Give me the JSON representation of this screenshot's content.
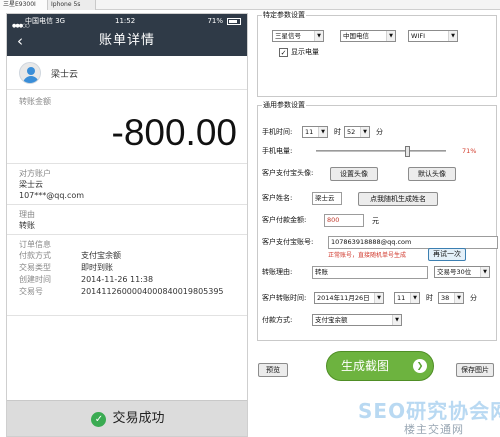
{
  "window_tabs": [
    "三星E9300I",
    "Iphone 5s"
  ],
  "phone": {
    "status": {
      "signal": "●●●○○",
      "carrier": "中国电信  3G",
      "time": "11:52",
      "battery": "71%"
    },
    "nav": {
      "back": "‹",
      "title": "账单详情"
    },
    "user_name": "梁士云",
    "amount_label": "转账金额",
    "amount": "-800.00",
    "counterparty_label": "对方账户",
    "counterparty_name": "梁士云",
    "counterparty_account": "107***@qq.com",
    "reason_label": "理由",
    "reason_value": "转账",
    "order_label": "订单信息",
    "rows": [
      {
        "k": "付款方式",
        "v": "支付宝余额"
      },
      {
        "k": "交易类型",
        "v": "即时到账"
      },
      {
        "k": "创建时间",
        "v": "2014-11-26 11:38"
      },
      {
        "k": "交易号",
        "v": "2014112600004000840019805395"
      }
    ],
    "success_icon": "✓",
    "success_text": "交易成功"
  },
  "panel": {
    "device_group_title": "特定参数设置",
    "device_select": "三星信号",
    "carrier_select": "中国电信",
    "network_select": "WIFI",
    "show_battery_checked": "✓",
    "show_battery_label": "显示电量",
    "general_group_title": "通用参数设置",
    "phone_time_label": "手机时间:",
    "hour": "11",
    "hour_unit": "时",
    "minute": "52",
    "minute_unit": "分",
    "battery_label": "手机电量:",
    "battery_value": 71,
    "battery_pct": "71%",
    "avatar_label": "客户支付宝头像:",
    "set_avatar_button": "设置头像",
    "default_avatar_button": "默认头像",
    "name_label": "客户姓名:",
    "name_value": "梁士云",
    "random_name_button": "点我随机生成姓名",
    "amount_label": "客户付款金额:",
    "amount_value": "800",
    "amount_unit": "元",
    "account_label": "客户支付宝账号:",
    "account_value": "107863918888@qq.com",
    "warning_text": "正常账号，直接随机单号生成",
    "retry_button": "再试一次",
    "reason_label": "转账理由:",
    "reason_value": "转账",
    "trade_number_select": "交易号30位",
    "trade_time_label": "客户转账时间:",
    "trade_date": "2014年11月26日",
    "trade_hour": "11",
    "trade_hour_unit": "时",
    "trade_minute": "38",
    "trade_minute_unit": "分",
    "pay_method_label": "付款方式:",
    "pay_method_value": "支付宝余额",
    "preview_button": "预览",
    "generate_button": "生成截图",
    "generate_icon": "❯",
    "save_button": "保存图片",
    "watermark_main": "SEO研究协会网",
    "watermark_sub": "楼主交通网"
  },
  "colors": {
    "nav_bg": "#2f3a47",
    "success_green": "#3aab52",
    "generate_green": "#6db33f",
    "warning_red": "#d0362a"
  },
  "icons": [
    "back-icon",
    "avatar-icon",
    "check-circle-icon",
    "arrow-right-icon",
    "dropdown-arrow-icon",
    "checkbox-icon"
  ]
}
